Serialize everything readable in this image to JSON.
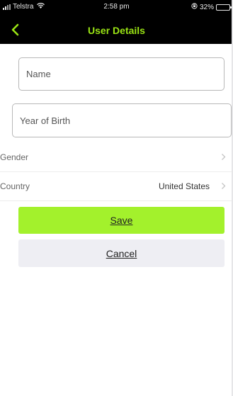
{
  "status_bar": {
    "carrier": "Telstra",
    "time": "2:58 pm",
    "battery": "32%",
    "battery_level": 0.32
  },
  "nav": {
    "title": "User Details",
    "back_icon": "chevron-left-icon",
    "accent_color": "#9ae414"
  },
  "form": {
    "name_placeholder": "Name",
    "name_value": "",
    "year_placeholder": "Year of Birth",
    "year_value": "",
    "gender_label": "Gender",
    "gender_value": "",
    "country_label": "Country",
    "country_value": "United States"
  },
  "actions": {
    "save_label": "Save",
    "cancel_label": "Cancel",
    "save_color": "#a3f12c"
  }
}
